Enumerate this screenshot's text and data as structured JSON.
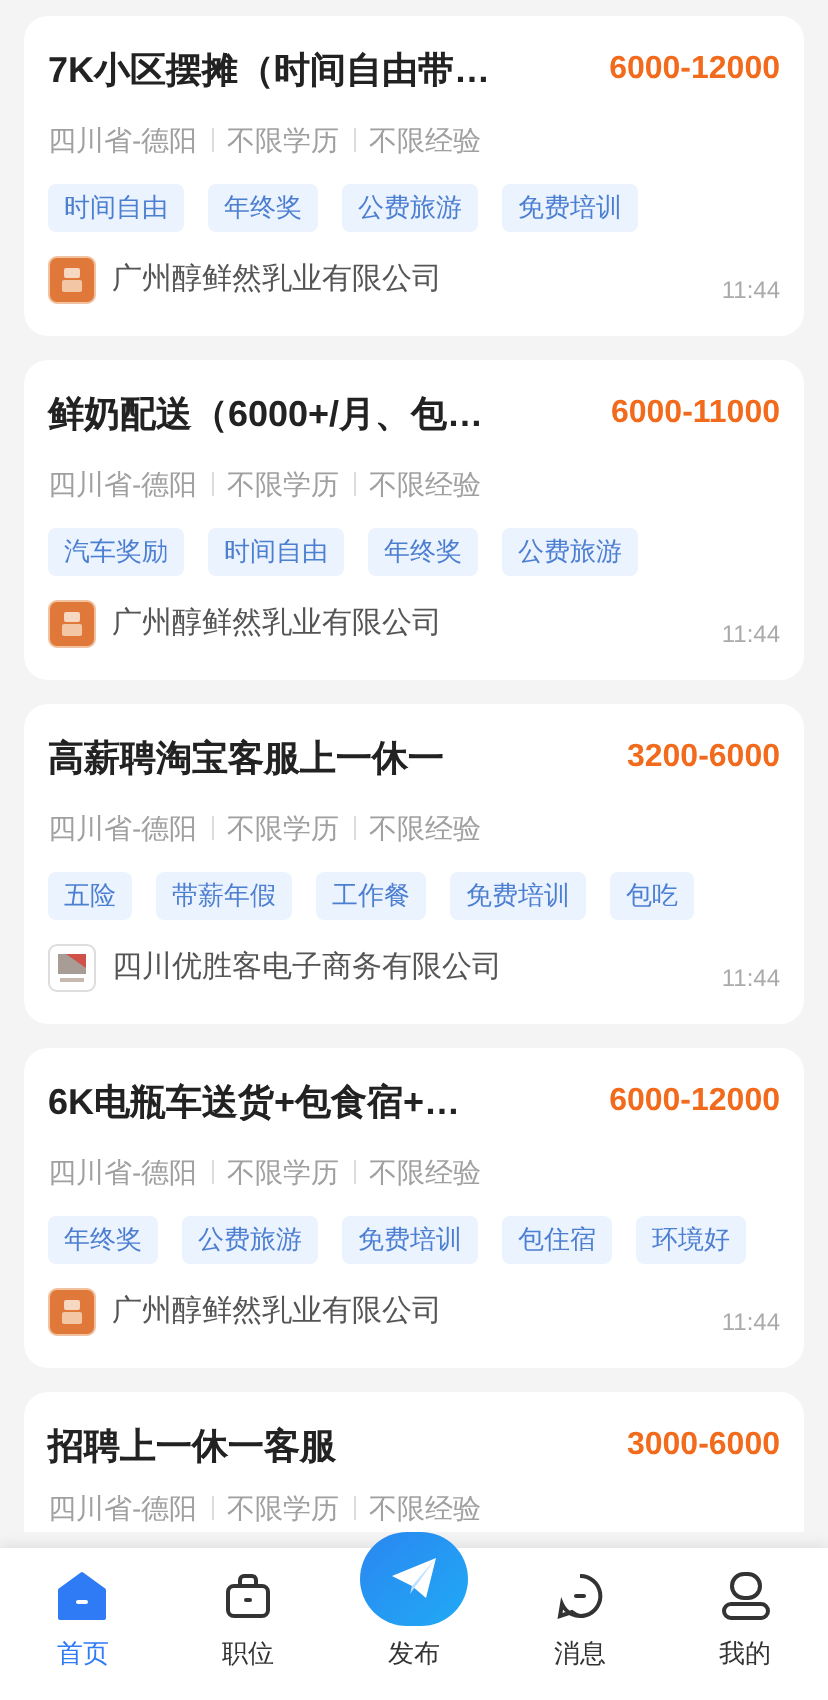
{
  "jobs": [
    {
      "title": "7K小区摆摊（时间自由带…",
      "salary": "6000-12000",
      "meta": [
        "四川省-德阳",
        "不限学历",
        "不限经验"
      ],
      "tags": [
        "时间自由",
        "年终奖",
        "公费旅游",
        "免费培训"
      ],
      "company": "广州醇鲜然乳业有限公司",
      "kind": "orange",
      "time": "11:44"
    },
    {
      "title": "鲜奶配送（6000+/月、包…",
      "salary": "6000-11000",
      "meta": [
        "四川省-德阳",
        "不限学历",
        "不限经验"
      ],
      "tags": [
        "汽车奖励",
        "时间自由",
        "年终奖",
        "公费旅游"
      ],
      "company": "广州醇鲜然乳业有限公司",
      "kind": "orange",
      "time": "11:44"
    },
    {
      "title": "高薪聘淘宝客服上一休一",
      "salary": "3200-6000",
      "meta": [
        "四川省-德阳",
        "不限学历",
        "不限经验"
      ],
      "tags": [
        "五险",
        "带薪年假",
        "工作餐",
        "免费培训",
        "包吃"
      ],
      "company": "四川优胜客电子商务有限公司",
      "kind": "photo",
      "time": "11:44"
    },
    {
      "title": "6K电瓶车送货+包食宿+…",
      "salary": "6000-12000",
      "meta": [
        "四川省-德阳",
        "不限学历",
        "不限经验"
      ],
      "tags": [
        "年终奖",
        "公费旅游",
        "免费培训",
        "包住宿",
        "环境好"
      ],
      "company": "广州醇鲜然乳业有限公司",
      "kind": "orange",
      "time": "11:44"
    },
    {
      "title": "招聘上一休一客服",
      "salary": "3000-6000",
      "meta": [
        "四川省-德阳",
        "不限学历",
        "不限经验"
      ]
    }
  ],
  "nav": [
    {
      "label": "首页",
      "kind": "tab",
      "selected": true
    },
    {
      "label": "职位",
      "kind": "tab",
      "selected": false
    },
    {
      "label": "发布",
      "kind": "raised",
      "selected": false
    },
    {
      "label": "消息",
      "kind": "tab",
      "selected": false
    },
    {
      "label": "我的",
      "kind": "tab",
      "selected": false
    }
  ]
}
